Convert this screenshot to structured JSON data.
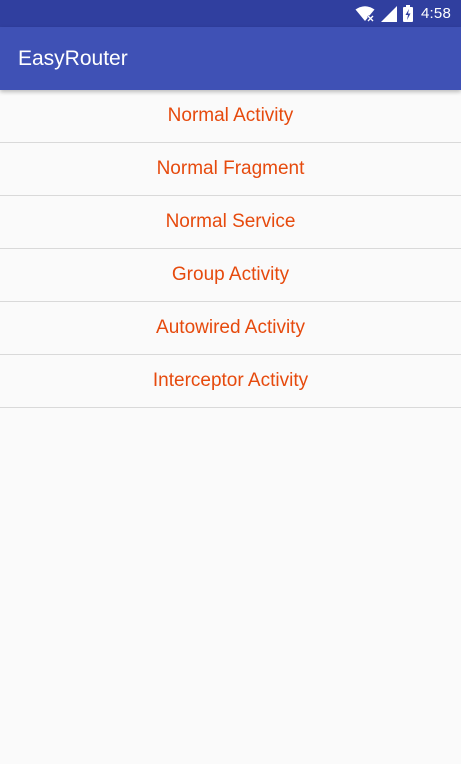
{
  "status_bar": {
    "time": "4:58",
    "icons": [
      "wifi-icon",
      "signal-icon",
      "battery-icon"
    ]
  },
  "app_bar": {
    "title": "EasyRouter"
  },
  "menu": {
    "items": [
      {
        "label": "Normal Activity"
      },
      {
        "label": "Normal Fragment"
      },
      {
        "label": "Normal Service"
      },
      {
        "label": "Group Activity"
      },
      {
        "label": "Autowired Activity"
      },
      {
        "label": "Interceptor Activity"
      }
    ]
  },
  "colors": {
    "status_bar": "#303f9f",
    "app_bar": "#3f51b5",
    "item_text": "#e64a0d",
    "background": "#fafafa"
  }
}
